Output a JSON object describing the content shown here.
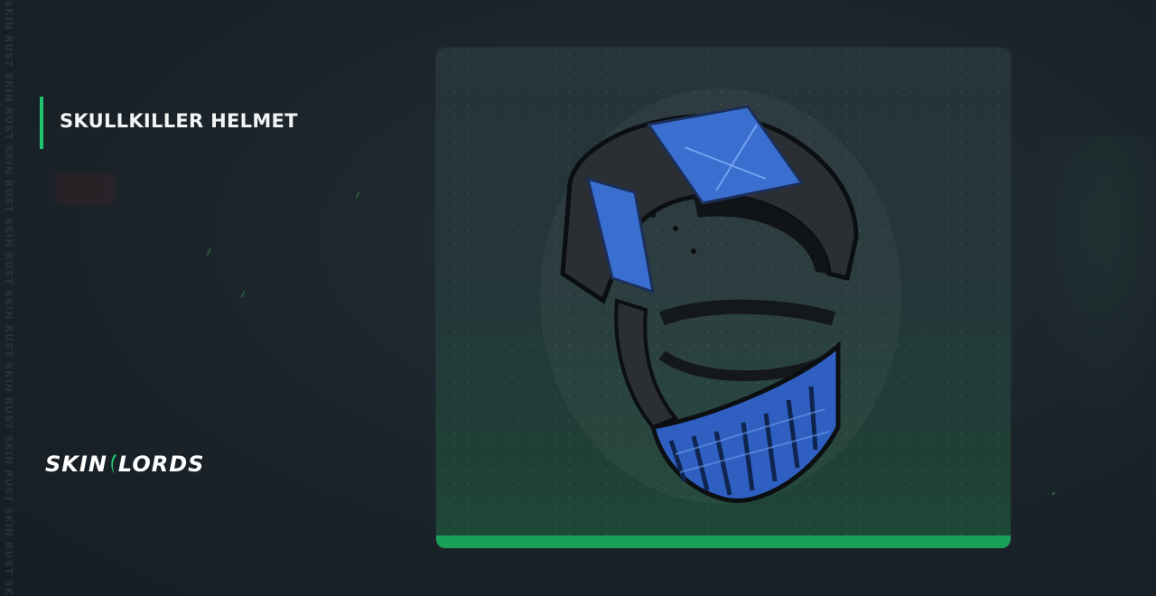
{
  "title": "SKULLKILLER HELMET",
  "brand": {
    "left": "SKIN",
    "right": "LORDS"
  },
  "watermark": "SKIN RUST SKIN RUST SKIN RUST SKIN RUST SKIN RUST SKIN RUST SKIN RUST SKIN RUST SKIN RUST SKIN RUST",
  "colors": {
    "accent": "#1ec46a",
    "card_bar": "#1aa158",
    "background": "#1c252c",
    "helmet_blue": "#3a6fd0"
  },
  "item_image": "skullkiller-helmet-icon"
}
